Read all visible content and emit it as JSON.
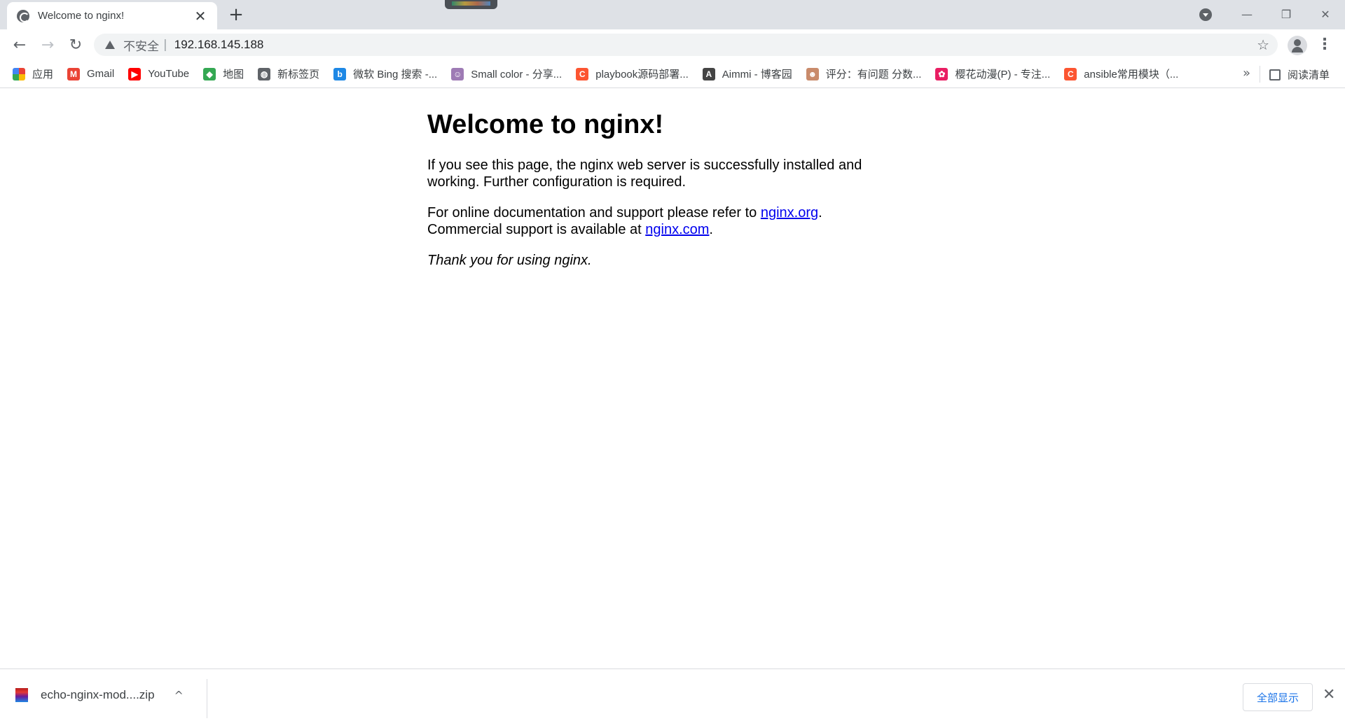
{
  "browser": {
    "tab": {
      "title": "Welcome to nginx!",
      "close": "✕"
    },
    "new_tab": "+",
    "window_controls": {
      "minimize": "—",
      "restore": "❐",
      "close": "✕"
    },
    "toolbar": {
      "back": "←",
      "forward": "→",
      "reload": "↻",
      "security_label": "不安全",
      "separator": "|",
      "url": "192.168.145.188",
      "bookmark_star": "☆",
      "menu": "⋮"
    },
    "bookmarks": [
      {
        "label": "应用",
        "icon": "apps-grid-icon",
        "color": "#4285f4"
      },
      {
        "label": "Gmail",
        "icon": "gmail-icon",
        "color": "#ea4335",
        "glyph": "M"
      },
      {
        "label": "YouTube",
        "icon": "youtube-icon",
        "color": "#ff0000",
        "glyph": "▶"
      },
      {
        "label": "地图",
        "icon": "maps-icon",
        "color": "#34a853",
        "glyph": "◆"
      },
      {
        "label": "新标签页",
        "icon": "globe-icon",
        "color": "#5f6368",
        "glyph": "◍"
      },
      {
        "label": "微软 Bing 搜索 -...",
        "icon": "bing-icon",
        "color": "#1e88e5",
        "glyph": "b"
      },
      {
        "label": "Small color - 分享...",
        "icon": "smallcolor-icon",
        "color": "#9e7bb5",
        "glyph": "☺"
      },
      {
        "label": "playbook源码部署...",
        "icon": "csdn-icon",
        "color": "#fc5531",
        "glyph": "C"
      },
      {
        "label": "Aimmi - 博客园",
        "icon": "cnblogs-icon",
        "color": "#444444",
        "glyph": "A"
      },
      {
        "label": "评分：有问题 分数...",
        "icon": "avatar-icon",
        "color": "#c98b6b",
        "glyph": "☻"
      },
      {
        "label": "樱花动漫(P) - 专注...",
        "icon": "flower-icon",
        "color": "#e91e63",
        "glyph": "✿"
      },
      {
        "label": "ansible常用模块（...",
        "icon": "csdn-icon",
        "color": "#fc5531",
        "glyph": "C"
      }
    ],
    "bookmarks_more": "»",
    "reading_list": "阅读清单"
  },
  "page": {
    "heading": "Welcome to nginx!",
    "para1": "If you see this page, the nginx web server is successfully installed and working. Further configuration is required.",
    "para2_prefix": "For online documentation and support please refer to ",
    "link_org": "nginx.org",
    "para2_mid": ".",
    "para2_line2": "Commercial support is available at ",
    "link_com": "nginx.com",
    "para2_end": ".",
    "thanks": "Thank you for using nginx."
  },
  "downloads": {
    "file_name": "echo-nginx-mod....zip",
    "chevron": "^",
    "show_all": "全部显示",
    "close": "✕"
  }
}
